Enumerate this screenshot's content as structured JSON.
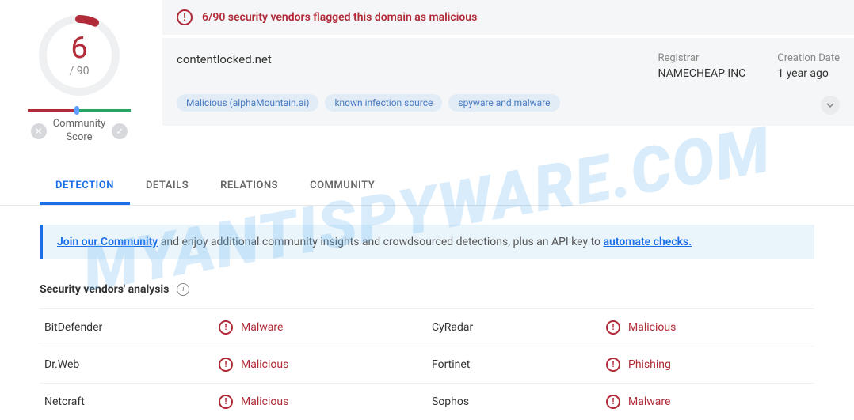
{
  "watermark": "MYANTISPYWARE.COM",
  "score": {
    "numerator": "6",
    "denominator": "/ 90",
    "label": "Community\nScore"
  },
  "alert": {
    "text": "6/90 security vendors flagged this domain as malicious"
  },
  "domain": "contentlocked.net",
  "meta": {
    "registrar_label": "Registrar",
    "registrar_value": "NAMECHEAP INC",
    "created_label": "Creation Date",
    "created_value": "1 year ago"
  },
  "tags": [
    "Malicious (alphaMountain.ai)",
    "known infection source",
    "spyware and malware"
  ],
  "tabs": [
    "DETECTION",
    "DETAILS",
    "RELATIONS",
    "COMMUNITY"
  ],
  "community_banner": {
    "link1": "Join our Community",
    "mid": " and enjoy additional community insights and crowdsourced detections, plus an API key to ",
    "link2": "automate checks."
  },
  "section_title": "Security vendors' analysis",
  "vendors": [
    [
      {
        "name": "BitDefender",
        "verdict": "Malware"
      },
      {
        "name": "CyRadar",
        "verdict": "Malicious"
      }
    ],
    [
      {
        "name": "Dr.Web",
        "verdict": "Malicious"
      },
      {
        "name": "Fortinet",
        "verdict": "Phishing"
      }
    ],
    [
      {
        "name": "Netcraft",
        "verdict": "Malicious"
      },
      {
        "name": "Sophos",
        "verdict": "Malware"
      }
    ]
  ]
}
